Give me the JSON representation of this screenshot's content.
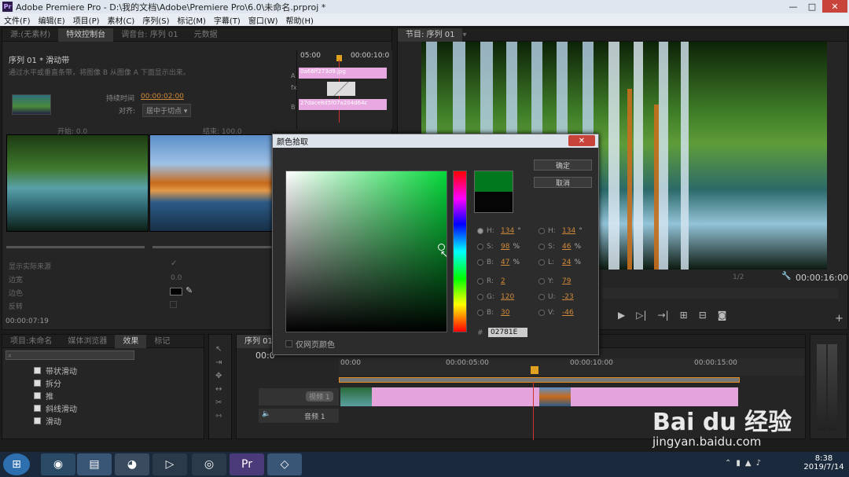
{
  "window": {
    "title": "Adobe Premiere Pro - D:\\我的文档\\Adobe\\Premiere Pro\\6.0\\未命名.prproj *",
    "logo": "Pr",
    "minimize": "—",
    "maximize": "□",
    "close": "✕"
  },
  "menu": [
    "文件(F)",
    "编辑(E)",
    "项目(P)",
    "素材(C)",
    "序列(S)",
    "标记(M)",
    "字幕(T)",
    "窗口(W)",
    "帮助(H)"
  ],
  "source_panel": {
    "tabs": [
      "源:(无素材)",
      "特效控制台",
      "调音台: 序列 01",
      "元数据"
    ],
    "sequence_label": "序列 01 * 滑动带",
    "description": "通过水平或垂直条带，将图像 B 从图像 A 下面显示出来。",
    "duration_label": "持续时间",
    "duration_value": "00:00:02:00",
    "align_label": "对齐:",
    "align_value": "居中于切点",
    "start_label": "开始: 0.0",
    "end_label": "结束: 100.0",
    "show_actual_label": "显示实际来源",
    "border_label": "边宽",
    "border_value": "0.0",
    "color_label": "边色",
    "reverse_label": "反转",
    "timecode": "00:00:07:19",
    "tl_time_a": "05:00",
    "tl_time_b": "00:00:10:0",
    "track_a": "A",
    "track_fx": "fx",
    "track_b": "B",
    "clip_a": "0a66ff273d9.jpg",
    "clip_b": "27dace8d5f07a204d64c"
  },
  "program_panel": {
    "title": "节目: 序列 01",
    "resolution": "1/2",
    "timecode": "00:00:16:00"
  },
  "dialog": {
    "title": "颜色拾取",
    "close": "✕",
    "ok": "确定",
    "cancel": "取消",
    "web_safe_label": "仅网页颜色",
    "hex": "02781E",
    "new_color": "#02781e",
    "old_color": "#050505",
    "fields_left": [
      {
        "k": "H:",
        "v": "134",
        "u": "°"
      },
      {
        "k": "S:",
        "v": "98",
        "u": "%"
      },
      {
        "k": "B:",
        "v": "47",
        "u": "%"
      },
      {
        "k": "R:",
        "v": "2",
        "u": ""
      },
      {
        "k": "G:",
        "v": "120",
        "u": ""
      },
      {
        "k": "B:",
        "v": "30",
        "u": ""
      }
    ],
    "fields_right": [
      {
        "k": "H:",
        "v": "134",
        "u": "°"
      },
      {
        "k": "S:",
        "v": "46",
        "u": "%"
      },
      {
        "k": "L:",
        "v": "24",
        "u": "%"
      },
      {
        "k": "Y:",
        "v": "79",
        "u": ""
      },
      {
        "k": "U:",
        "v": "-23",
        "u": ""
      },
      {
        "k": "V:",
        "v": "-46",
        "u": ""
      }
    ],
    "hash": "#"
  },
  "project_panel": {
    "tabs": [
      "项目:未命名",
      "媒体浏览器",
      "效果",
      "标记"
    ],
    "effects": [
      "带状滑动",
      "拆分",
      "推",
      "斜线滑动",
      "滑动"
    ]
  },
  "timeline": {
    "tab": "序列 01",
    "timecode": "00:0",
    "ticks": [
      "00:00",
      "00:00:05:00",
      "00:00:10:00",
      "00:00:15:00"
    ],
    "video_label": "视频 1",
    "audio_label": "音频 1"
  },
  "taskbar": {
    "time": "8:38",
    "date": "2019/7/14"
  },
  "watermark": {
    "brand": "Bai du 经验",
    "url": "jingyan.baidu.com"
  }
}
